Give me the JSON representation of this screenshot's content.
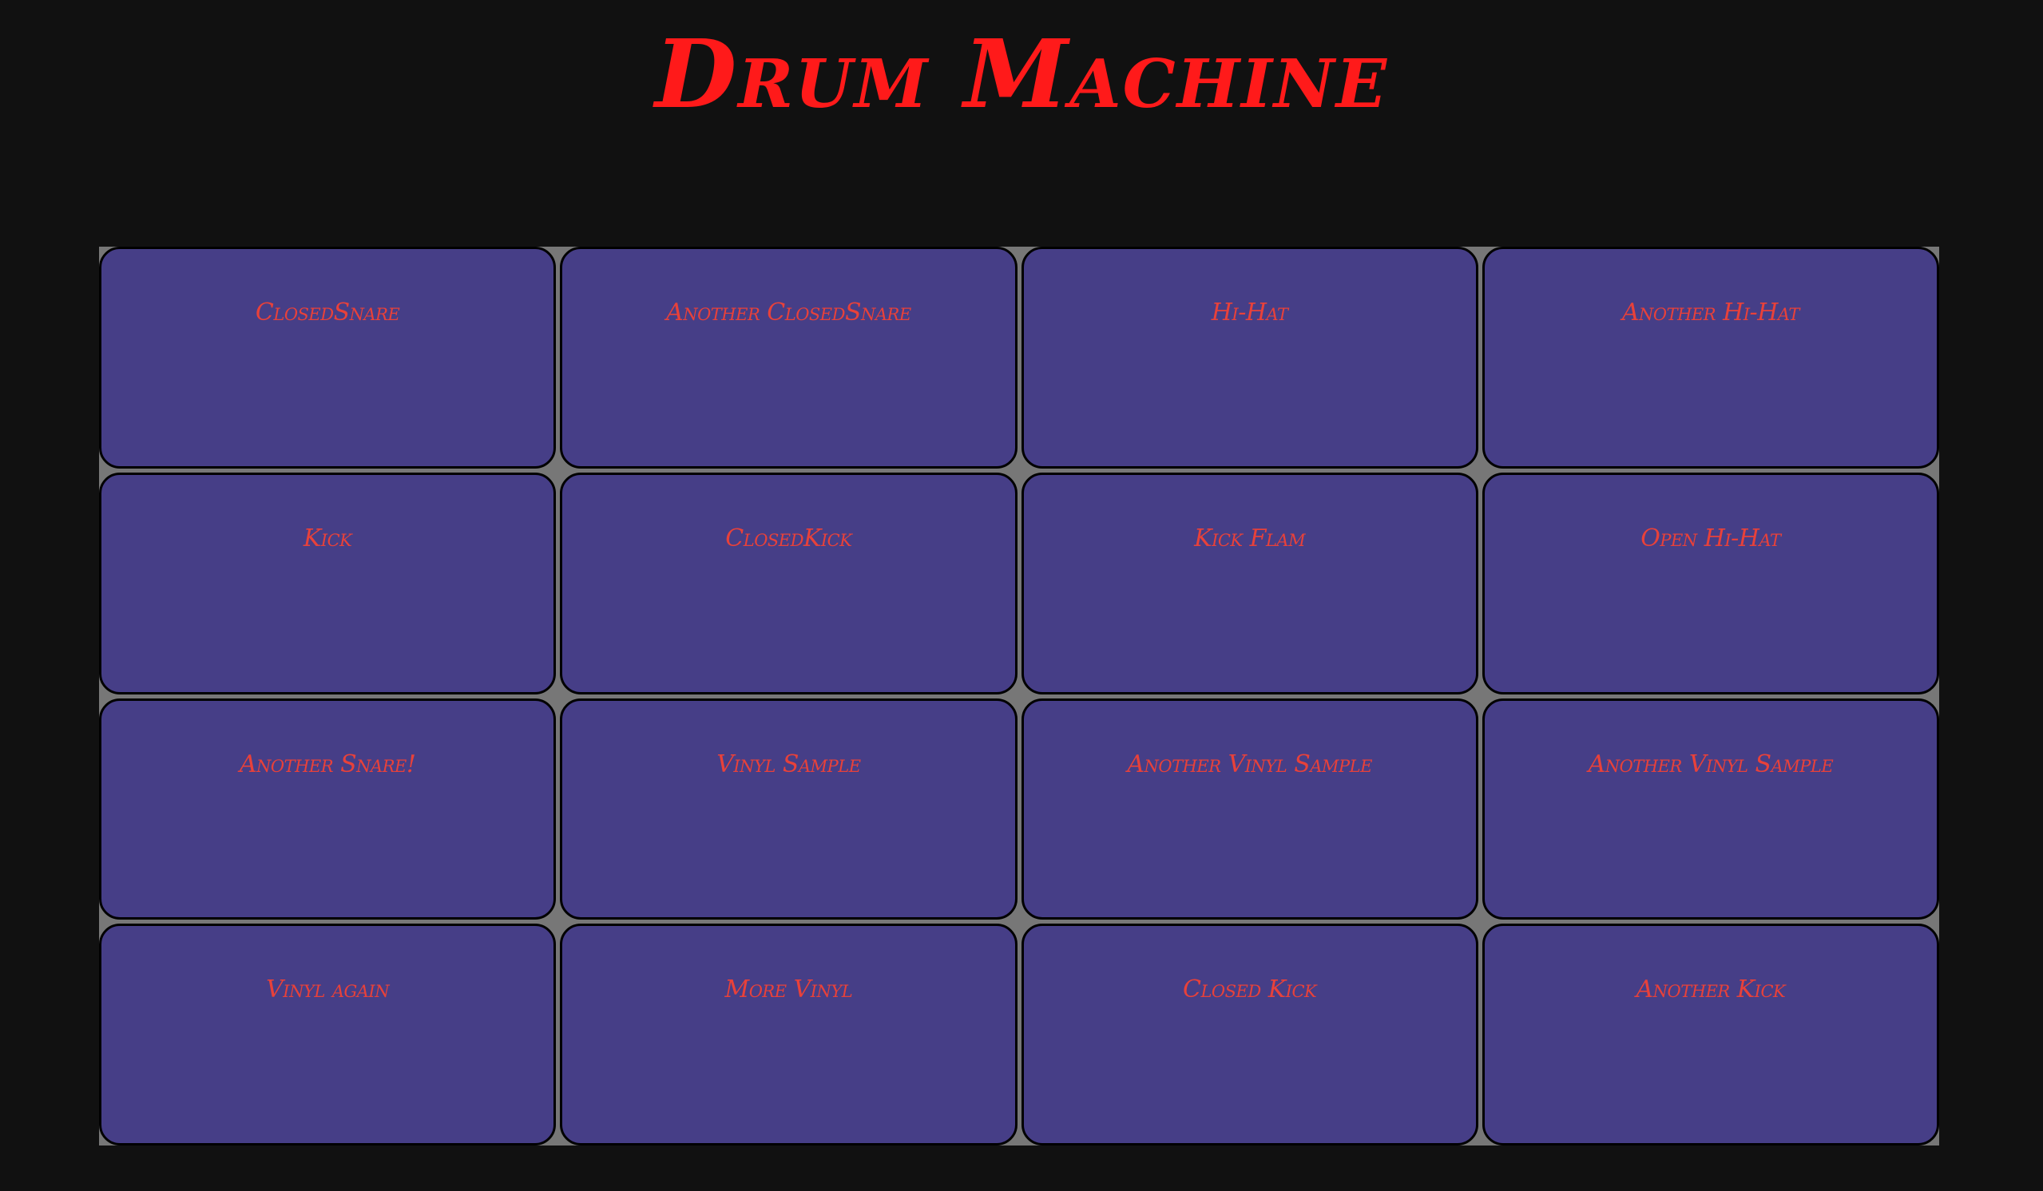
{
  "app": {
    "title": "Drum Machine"
  },
  "colors": {
    "background": "#111111",
    "title": "#ff1a1a",
    "pad_fill": "#463e87",
    "pad_border": "#000000",
    "pad_label": "#e8413a",
    "grid_gap": "#777777"
  },
  "pads": [
    {
      "label": "ClosedSnare"
    },
    {
      "label": "Another ClosedSnare"
    },
    {
      "label": "Hi-Hat"
    },
    {
      "label": "Another Hi-Hat"
    },
    {
      "label": "Kick"
    },
    {
      "label": "ClosedKick"
    },
    {
      "label": "Kick Flam"
    },
    {
      "label": "Open Hi-Hat"
    },
    {
      "label": "Another Snare!"
    },
    {
      "label": "Vinyl Sample"
    },
    {
      "label": "Another Vinyl Sample"
    },
    {
      "label": "Another Vinyl Sample"
    },
    {
      "label": "Vinyl again"
    },
    {
      "label": "More Vinyl"
    },
    {
      "label": "Closed Kick"
    },
    {
      "label": "Another Kick"
    }
  ]
}
